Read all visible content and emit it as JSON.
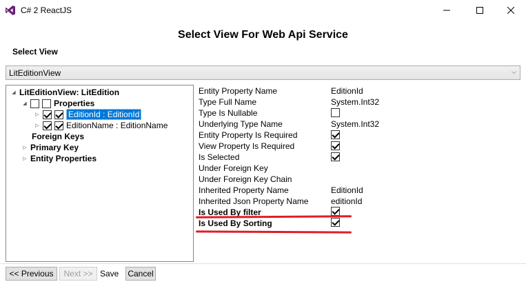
{
  "window": {
    "title": "C# 2 ReactJS"
  },
  "page": {
    "title": "Select View For Web Api Service",
    "select_view_label": "Select View",
    "selected_view": "LitEditionView"
  },
  "tree": {
    "root": "LitEditionView: LitEdition",
    "properties": "Properties",
    "items": [
      {
        "label": "EditionId : EditionId",
        "checked": true,
        "selected": true
      },
      {
        "label": "EditionName : EditionName",
        "checked": true,
        "selected": false
      }
    ],
    "foreign_keys": "Foreign Keys",
    "primary_key": "Primary Key",
    "entity_properties": "Entity Properties"
  },
  "properties": {
    "entity_property_name": {
      "label": "Entity Property Name",
      "value": "EditionId"
    },
    "type_full_name": {
      "label": "Type Full Name",
      "value": "System.Int32"
    },
    "type_is_nullable": {
      "label": "Type Is Nullable",
      "checked": false
    },
    "underlying_type_name": {
      "label": "Underlying Type Name",
      "value": "System.Int32"
    },
    "entity_property_is_required": {
      "label": "Entity Property Is Required",
      "checked": true
    },
    "view_property_is_required": {
      "label": "View Property Is Required",
      "checked": true
    },
    "is_selected": {
      "label": "Is Selected",
      "checked": true
    },
    "under_foreign_key": {
      "label": "Under Foreign Key"
    },
    "under_foreign_key_chain": {
      "label": "Under Foreign Key Chain"
    },
    "inherited_property_name": {
      "label": "Inherited Property Name",
      "value": "EditionId"
    },
    "inherited_json_property_name": {
      "label": "Inherited Json Property Name",
      "value": "editionId"
    },
    "is_used_by_filter": {
      "label": "Is Used By filter",
      "checked": true
    },
    "is_used_by_sorting": {
      "label": "Is Used By Sorting",
      "checked": true
    }
  },
  "buttons": {
    "previous": "<< Previous",
    "next": "Next >>",
    "save": "Save",
    "cancel": "Cancel"
  },
  "colors": {
    "highlight": "#e31b23",
    "selection": "#0078d7",
    "vs_icon": "#68217a"
  }
}
